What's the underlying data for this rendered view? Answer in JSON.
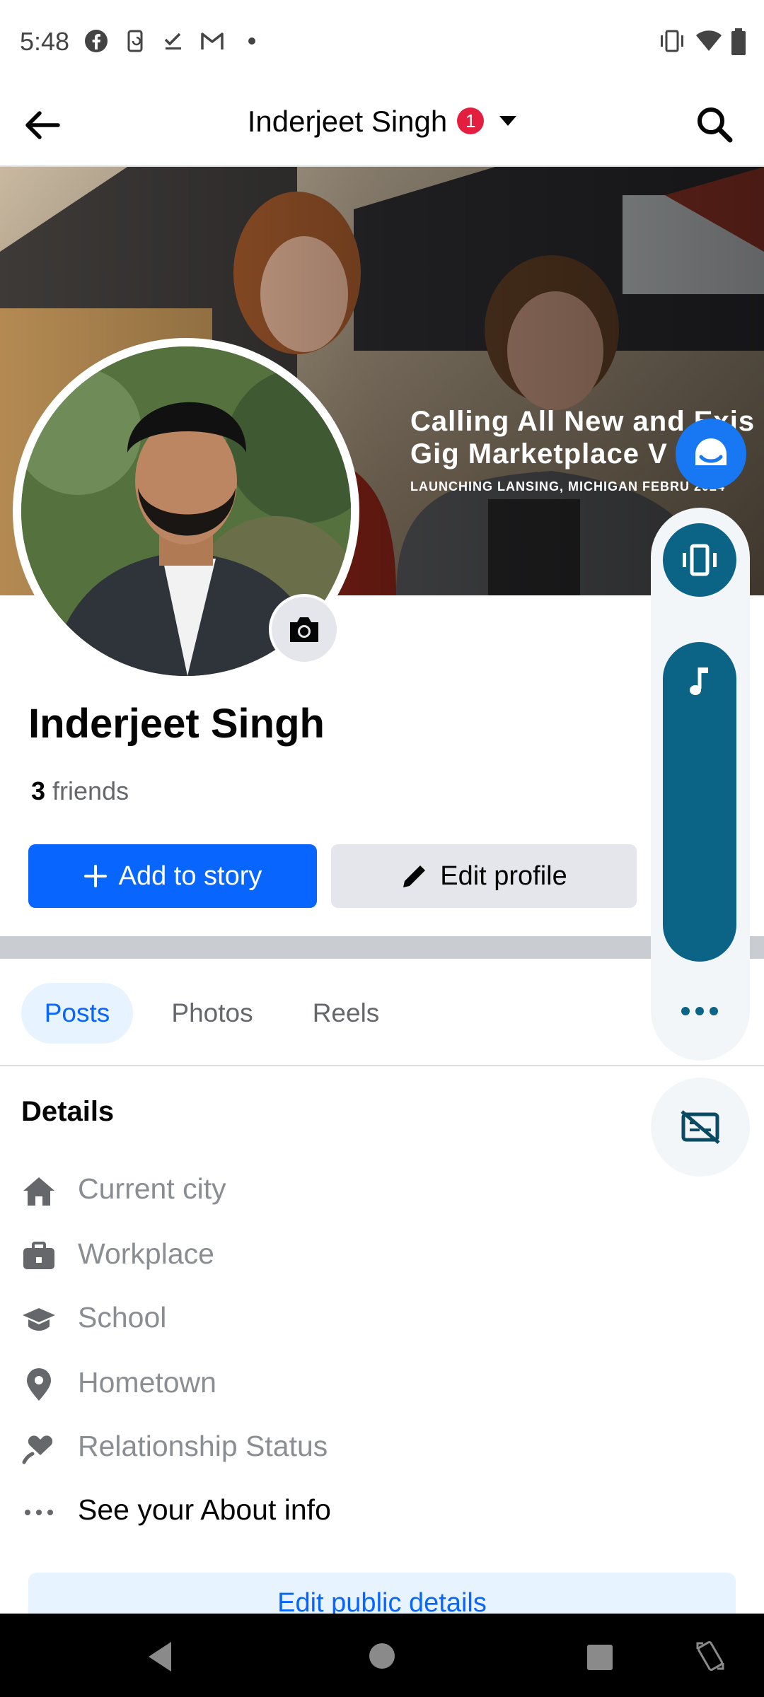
{
  "status_bar": {
    "time": "5:48",
    "notification_icons": [
      "facebook-icon",
      "phone-sync-icon",
      "check-icon",
      "gmail-icon",
      "dot-icon"
    ],
    "system_icons": [
      "vibrate-icon",
      "wifi-icon",
      "battery-icon"
    ]
  },
  "header": {
    "title": "Inderjeet Singh",
    "badge_count": "1"
  },
  "cover": {
    "headline_line1": "Calling All New and Exis",
    "headline_line2": "Gig Marketplace V",
    "subline": "LAUNCHING LANSING, MICHIGAN FEBRU      2024"
  },
  "profile": {
    "name": "Inderjeet Singh",
    "friends_count": "3",
    "friends_label": "friends"
  },
  "actions": {
    "add_story": "Add to story",
    "edit_profile": "Edit profile"
  },
  "tabs": [
    {
      "label": "Posts",
      "selected": true
    },
    {
      "label": "Photos",
      "selected": false
    },
    {
      "label": "Reels",
      "selected": false
    }
  ],
  "details": {
    "title": "Details",
    "items": [
      {
        "icon": "home-icon",
        "label": "Current city"
      },
      {
        "icon": "briefcase-icon",
        "label": "Workplace"
      },
      {
        "icon": "graduation-cap-icon",
        "label": "School"
      },
      {
        "icon": "location-pin-icon",
        "label": "Hometown"
      },
      {
        "icon": "heart-icon",
        "label": "Relationship Status"
      },
      {
        "icon": "more-dots-icon",
        "label": "See your About info"
      }
    ],
    "edit_public_details": "Edit public details"
  },
  "colors": {
    "brand_blue": "#0866ff",
    "volume_teal": "#0b6385",
    "badge_red": "#e41e3f"
  }
}
